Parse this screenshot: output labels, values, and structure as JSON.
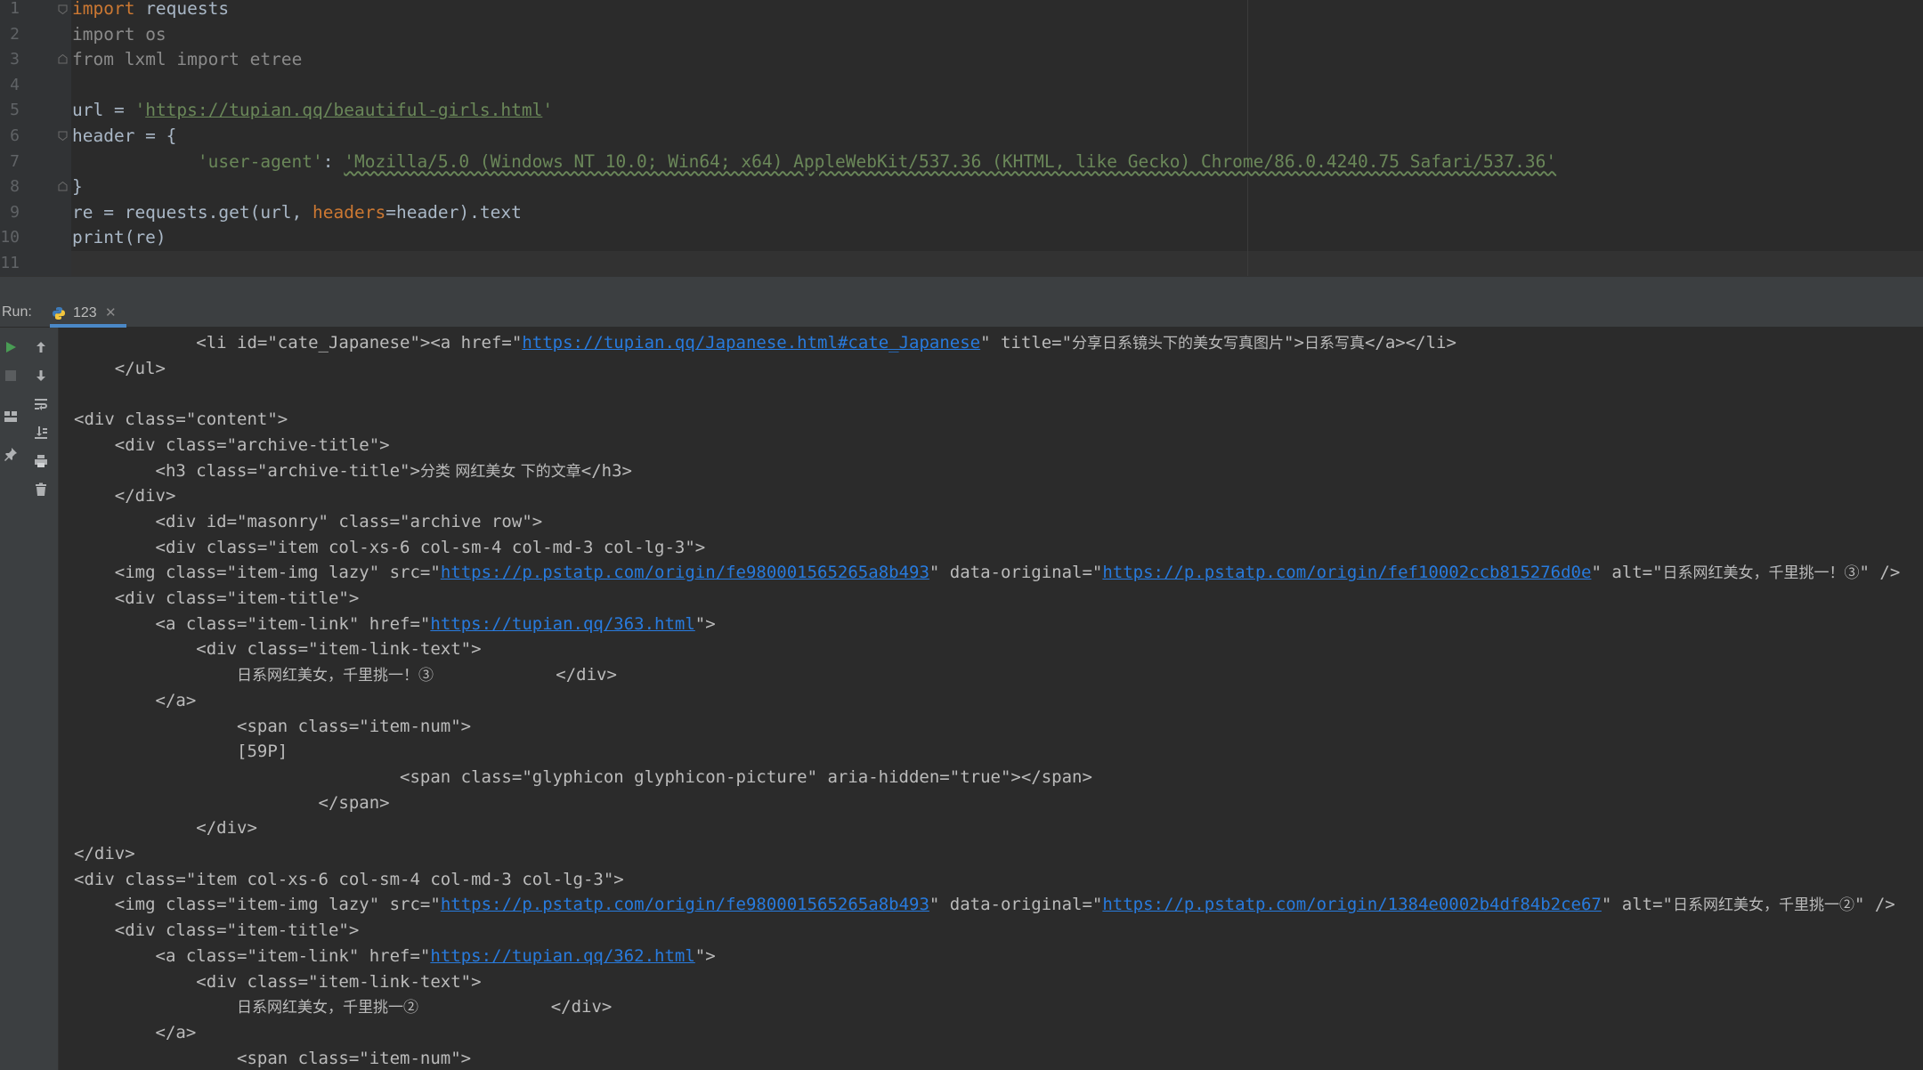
{
  "editor": {
    "line_numbers": [
      "1",
      "2",
      "3",
      "4",
      "5",
      "6",
      "7",
      "8",
      "9",
      "10",
      "11"
    ],
    "code": {
      "l1_kw": "import",
      "l1_rest": " requests",
      "l2_kw": "import",
      "l2_rest": " os",
      "l3_kw": "from",
      "l3_mod": " lxml ",
      "l3_kw2": "import",
      "l3_rest": " etree",
      "l5_pre": "url = ",
      "l5_q1": "'",
      "l5_url": "https://tupian.qq/beautiful-girls.html",
      "l5_q2": "'",
      "l6": "header = {",
      "l7_indent": "            ",
      "l7_key": "'user-agent'",
      "l7_colon": ": ",
      "l7_val": "'Mozilla/5.0 (Windows NT 10.0; Win64; x64) AppleWebKit/537.36 (KHTML, like Gecko) Chrome/86.0.4240.75 Safari/537.36'",
      "l8": "}",
      "l9_a": "re = requests.get(url, ",
      "l9_param": "headers",
      "l9_b": "=header).text",
      "l10": "print(re)"
    }
  },
  "run": {
    "label": "Run:",
    "tab_label": "123",
    "tab_close": "✕",
    "icons": [
      "run-icon",
      "stop-icon",
      "up-arrow-icon",
      "down-arrow-icon",
      "layout-icon",
      "soft-wrap-icon",
      "pin-icon",
      "scroll-to-end-icon",
      "print-icon",
      "trash-icon"
    ]
  },
  "console": {
    "l1_a": "            <li id=\"cate_Japanese\"><a href=\"",
    "l1_link": "https://tupian.qq/Japanese.html#cate_Japanese",
    "l1_b": "\" title=\"",
    "l1_cjk1": "分享日系镜头下的美女写真图片",
    "l1_c": "\">",
    "l1_cjk2": "日系写真",
    "l1_d": "</a></li>",
    "l2": "    </ul>",
    "l3": "",
    "l4": "<div class=\"content\">",
    "l5": "    <div class=\"archive-title\">",
    "l6_a": "        <h3 class=\"archive-title\">",
    "l6_cjk": "分类 网红美女 下的文章",
    "l6_b": "</h3>",
    "l7": "    </div>",
    "l8": "        <div id=\"masonry\" class=\"archive row\">",
    "l9": "        <div class=\"item col-xs-6 col-sm-4 col-md-3 col-lg-3\">",
    "l10_a": "    <img class=\"item-img lazy\" src=\"",
    "l10_link1": "https://p.pstatp.com/origin/fe980001565265a8b493",
    "l10_b": "\" data-original=\"",
    "l10_link2": "https://p.pstatp.com/origin/fef10002ccb815276d0e",
    "l10_c": "\" alt=\"",
    "l10_cjk": "日系网红美女，千里挑一！③",
    "l10_d": "\" />",
    "l11": "    <div class=\"item-title\">",
    "l12_a": "        <a class=\"item-link\" href=\"",
    "l12_link": "https://tupian.qq/363.html",
    "l12_b": "\">",
    "l13": "            <div class=\"item-link-text\">",
    "l14_pad": "                ",
    "l14_cjk": "日系网红美女，千里挑一！③",
    "l14_b": "            </div>",
    "l15": "        </a>",
    "l16": "                <span class=\"item-num\">",
    "l17": "                [59P]",
    "l18": "                                <span class=\"glyphicon glyphicon-picture\" aria-hidden=\"true\"></span>",
    "l19": "                        </span>",
    "l20": "            </div>",
    "l21": "</div>",
    "l22": "<div class=\"item col-xs-6 col-sm-4 col-md-3 col-lg-3\">",
    "l23_a": "    <img class=\"item-img lazy\" src=\"",
    "l23_link1": "https://p.pstatp.com/origin/fe980001565265a8b493",
    "l23_b": "\" data-original=\"",
    "l23_link2": "https://p.pstatp.com/origin/1384e0002b4df84b2ce67",
    "l23_c": "\" alt=\"",
    "l23_cjk": "日系网红美女，千里挑一②",
    "l23_d": "\" />",
    "l24": "    <div class=\"item-title\">",
    "l25_a": "        <a class=\"item-link\" href=\"",
    "l25_link": "https://tupian.qq/362.html",
    "l25_b": "\">",
    "l26": "            <div class=\"item-link-text\">",
    "l27_pad": "                ",
    "l27_cjk": "日系网红美女，千里挑一②",
    "l27_b": "             </div>",
    "l28": "        </a>",
    "l29": "                <span class=\"item-num\">"
  }
}
